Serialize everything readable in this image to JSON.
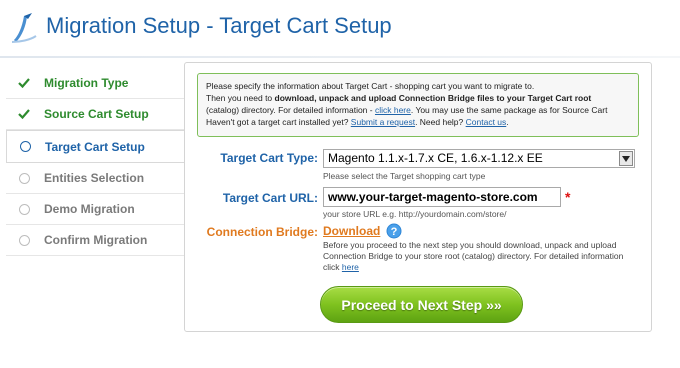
{
  "header": {
    "title": "Migration Setup - Target Cart Setup",
    "logo_icon": "migration-logo"
  },
  "sidebar": {
    "items": [
      {
        "label": "Migration Type",
        "state": "done"
      },
      {
        "label": "Source Cart Setup",
        "state": "done"
      },
      {
        "label": "Target Cart Setup",
        "state": "current"
      },
      {
        "label": "Entities Selection",
        "state": "pending"
      },
      {
        "label": "Demo Migration",
        "state": "pending"
      },
      {
        "label": "Confirm Migration",
        "state": "pending"
      }
    ]
  },
  "info": {
    "line1": "Please specify the information about Target Cart - shopping cart you want to migrate to.",
    "line2_prefix": "Then you need to ",
    "line2_bold": "download, unpack and upload Connection Bridge files to your Target Cart root",
    "line3_prefix": "(catalog) directory. For detailed information - ",
    "line3_link": "click here",
    "line3_suffix": ". You may use the same package as for Source Cart",
    "line4_prefix": "Haven't got a target cart installed yet? ",
    "line4_link1": "Submit a request",
    "line4_mid": ". Need help? ",
    "line4_link2": "Contact us",
    "line4_suffix": "."
  },
  "form": {
    "cart_type_label": "Target Cart Type:",
    "cart_type_value": "Magento 1.1.x-1.7.x CE, 1.6.x-1.12.x EE",
    "cart_type_hint": "Please select the Target shopping cart type",
    "cart_url_label": "Target Cart URL:",
    "cart_url_value": "www.your-target-magento-store.com",
    "required_mark": "*",
    "cart_url_hint": "your store URL e.g. http://yourdomain.com/store/",
    "bridge_label": "Connection Bridge:",
    "bridge_link": "Download",
    "bridge_text": "Before you proceed to the next step you should download, unpack and upload Connection Bridge to your store root (catalog) directory. For detailed information click ",
    "bridge_here": "here"
  },
  "actions": {
    "proceed_label": "Proceed to Next Step »»"
  },
  "colors": {
    "title_blue": "#1f63a8",
    "done_green": "#2e8b2e",
    "bridge_orange": "#e07a1f",
    "button_green": "#7fc21f",
    "info_border": "#7fbf5a"
  }
}
